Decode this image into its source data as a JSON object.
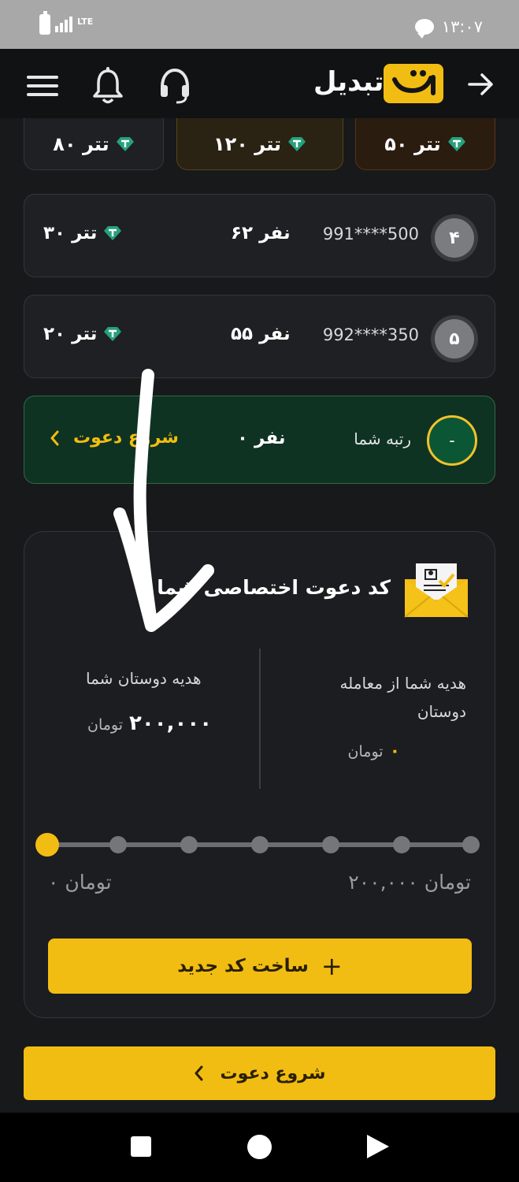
{
  "status_bar": {
    "network": "LTE",
    "time": "۱۳:۰۷"
  },
  "header": {
    "brand": "تبدیل"
  },
  "prizes": [
    {
      "label": "۸۰ تتر"
    },
    {
      "label": "۱۲۰ تتر"
    },
    {
      "label": "۵۰ تتر"
    }
  ],
  "ranks": [
    {
      "rank": "۴",
      "phone": "991****500",
      "count": "۶۲ نفر",
      "reward": "۳۰ تتر"
    },
    {
      "rank": "۵",
      "phone": "992****350",
      "count": "۵۵ نفر",
      "reward": "۲۰ تتر"
    }
  ],
  "my_rank": {
    "badge": "-",
    "label": "رتبه شما",
    "count": "۰ نفر",
    "cta": "شروع دعوت"
  },
  "invite": {
    "title": "کد دعوت اختصاصی شما",
    "friends_gift_label": "هدیه دوستان شما",
    "friends_gift_value": "۲۰۰,۰۰۰",
    "friends_gift_unit": "تومان",
    "your_gift_label": "هدیه شما از معامله دوستان",
    "your_gift_value": "۰",
    "your_gift_unit": "تومان",
    "slider_min": "۰ تومان",
    "slider_max": "۲۰۰,۰۰۰ تومان",
    "slider_level": 0,
    "create_label": "ساخت کد جدید"
  },
  "start_invite_label": "شروع دعوت",
  "colors": {
    "accent": "#f2bd12",
    "tether": "#26a17b"
  }
}
